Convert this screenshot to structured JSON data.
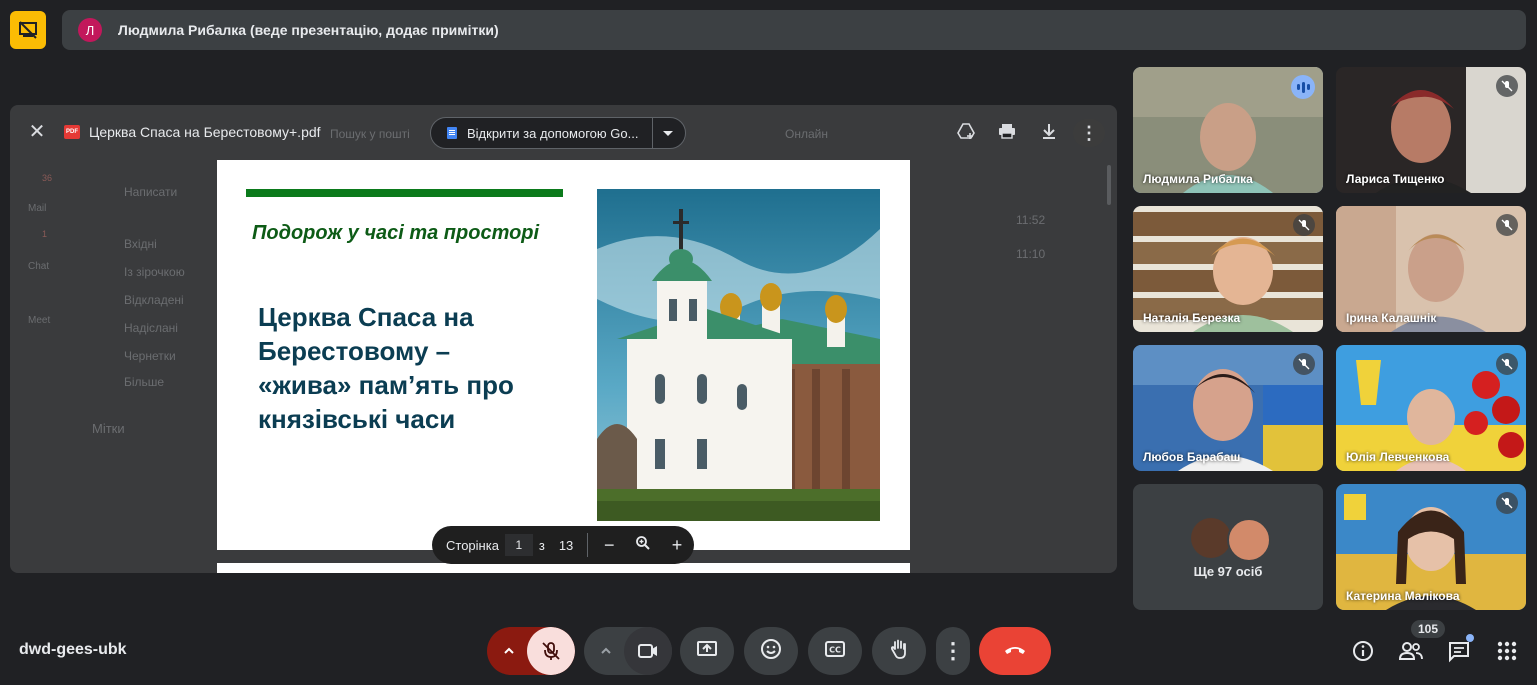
{
  "banner": {
    "avatar_letter": "Л",
    "presenter_text": "Людмила Рибалка (веде презентацію, додає примітки)"
  },
  "viewer": {
    "file_name": "Церква Спаса на Берестовому+.pdf",
    "open_with_label": "Відкрити за допомогою Go...",
    "icons": [
      "close-icon",
      "pdf-icon",
      "docs-icon",
      "add-to-drive-icon",
      "print-icon",
      "download-icon",
      "more-vert-icon"
    ]
  },
  "background_ghost": {
    "compose": "Написати",
    "search": "Пошук у пошті",
    "status": "Онлайн",
    "nav": [
      "Вхідні",
      "Із зірочкою",
      "Відкладені",
      "Надіслані",
      "Чернетки",
      "Більше"
    ],
    "labels_heading": "Мітки",
    "rail": [
      "Mail",
      "Chat",
      "Meet"
    ],
    "rail_badges": [
      "36",
      "1"
    ],
    "times": [
      "11:52",
      "11:10"
    ]
  },
  "slide": {
    "subtitle": "Подорож у часі та просторі",
    "title_lines": [
      "Церква Спаса на",
      "Берестовому –",
      "«жива» пам’ять про",
      "князівські часи"
    ]
  },
  "pager": {
    "label": "Сторінка",
    "current": "1",
    "of": "з",
    "total": "13"
  },
  "participants": [
    {
      "name": "Людмила Рибалка",
      "speaking": true
    },
    {
      "name": "Лариса Тищенко",
      "muted": true
    },
    {
      "name": "Наталія Березка",
      "muted": true
    },
    {
      "name": "Ірина Калашнік",
      "muted": true
    },
    {
      "name": "Любов Барабаш",
      "muted": true
    },
    {
      "name": "Юлія Левченкова",
      "muted": true
    },
    {
      "name": "Катерина Малікова",
      "muted": true
    }
  ],
  "more_participants": "Ще 97 осіб",
  "bottom_bar": {
    "meeting_code": "dwd-gees-ubk",
    "participant_count": "105",
    "controls": [
      "mic-off-icon",
      "camera-icon",
      "present-icon",
      "emoji-icon",
      "captions-icon",
      "raise-hand-icon",
      "more-vert-icon",
      "end-call-icon"
    ],
    "right_icons": [
      "info-icon",
      "people-icon",
      "chat-icon",
      "activities-icon"
    ]
  },
  "colors": {
    "background": "#202124",
    "end_call": "#ea4335",
    "mic_off": "#f9dedc",
    "accent_blue": "#8ab4f8",
    "slide_green": "#0b7a1b"
  }
}
